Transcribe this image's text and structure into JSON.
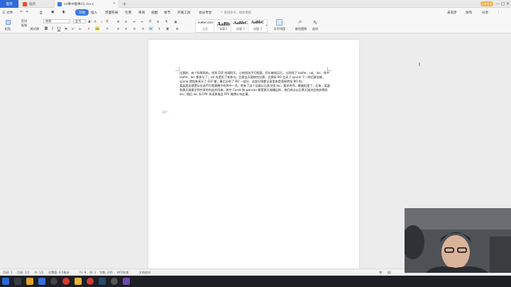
{
  "tabs": {
    "home": "首页",
    "daoke": "稻壳",
    "doc": "lol赛中趣事01.docx",
    "new_tab": "+"
  },
  "header_right": {
    "login": "立即登录",
    "minimize": "—",
    "restore": "□",
    "close": "✕"
  },
  "menu": {
    "file": "三 文件",
    "start": "开始",
    "insert": "插入",
    "layout": "页面布局",
    "reference": "引用",
    "review": "审阅",
    "view": "视图",
    "chapter": "章节",
    "dev": "开发工具",
    "member": "会员专享",
    "search_placeholder": "查找命令、搜索模板",
    "unsync": "未同步",
    "collab": "协作",
    "share": "分享"
  },
  "ribbon": {
    "paste": "粘贴",
    "format_painter": "格式刷",
    "cut": "剪切",
    "copy": "复制",
    "font": "宋体",
    "size": "五号",
    "bold": "B",
    "italic": "I",
    "underline": "U",
    "styles": [
      {
        "sample": "AaBbCcDd",
        "label": "正文"
      },
      {
        "sample": "AaBb",
        "label": "标题 1"
      },
      {
        "sample": "AaBbC",
        "label": "标题 2"
      },
      {
        "sample": "AaBbC",
        "label": "标题 3"
      }
    ],
    "text_tools": "文字排版",
    "find_replace": "查找替换",
    "select": "选择"
  },
  "document": {
    "paragraphs": [
      "比赛前，有个叫周雨的，找到 ESF 经理阿乐，让他找选手打假赛。阿乐被收买后，分别找了 laofer、rat、lec、其中 laofer、lec 都参与了，rat 先是拒了来参与。比赛当天德纳克比赛，比赛前 BO 告诉了 spunk 下一持比赛会输，spunk 就找来高天了 ESF 输，事后分给了 BO 一部分，这部分钱都记录里来是直接转给 BO 的。",
      "某晶其实就是队长选手打假赛圈子的其中一员，他有了这个证据以后多次找 lec，要求合作，都被拒绝了，后来，某晶和黄天瑞意识到共享的利益共同体，其中 Condi 和 weixian 都是黄天瑞撮出的，他们商议以后黄天瑞决定放弃揭发 lec，随后 lec 向 FPX 承诺那指出 FPX 微博公布此事。"
    ]
  },
  "status": {
    "page": "页码: 1",
    "pages": "页面: 1/1",
    "section": "节: 1/1",
    "position": "设置值: 6.5厘米",
    "row": "行: 9",
    "col": "列: 1",
    "words": "字数: 245",
    "spell": "拼写检查",
    "compare": "文档校对"
  }
}
